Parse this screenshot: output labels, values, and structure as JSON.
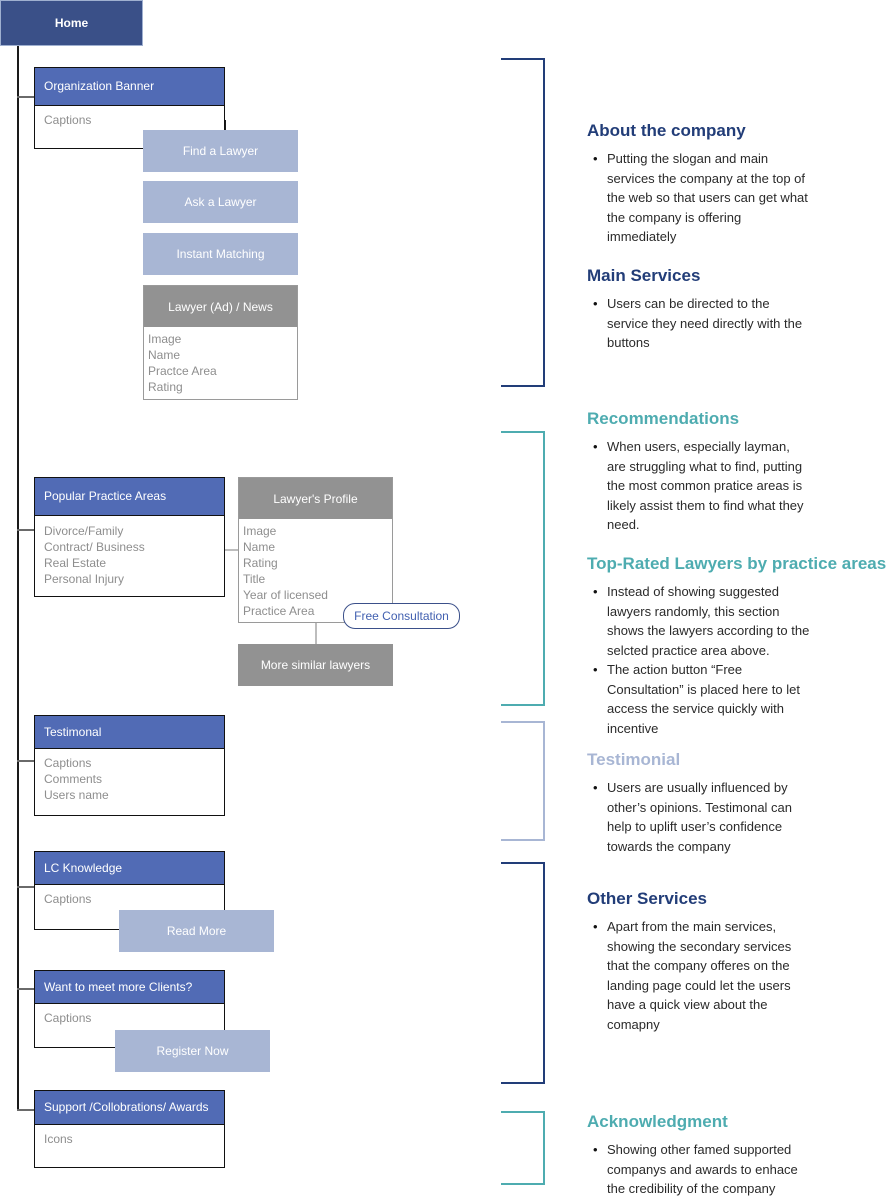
{
  "colors": {
    "dark_navy": "#223d78",
    "teal": "#4eacb0",
    "light_blue": "#a8b6d4",
    "section_header": "#516bb5",
    "home": "#3a5088",
    "grey": "#929292"
  },
  "home": {
    "label": "Home"
  },
  "sections": [
    {
      "title": "Organization Banner",
      "items": [
        "Captions"
      ]
    },
    {
      "title": "Popular Practice Areas",
      "items": [
        "Divorce/Family",
        "Contract/ Business",
        "Real Estate",
        "Personal Injury"
      ]
    },
    {
      "title": "Testimonal",
      "items": [
        "Captions",
        "Comments",
        "Users name"
      ]
    },
    {
      "title": "LC Knowledge",
      "items": [
        "Captions"
      ]
    },
    {
      "title": "Want to meet more Clients?",
      "items": [
        "Captions"
      ]
    },
    {
      "title": "Support /Collobrations/ Awards",
      "items": [
        "Icons"
      ]
    }
  ],
  "main_services_buttons": [
    "Find a Lawyer",
    "Ask a Lawyer",
    "Instant Matching"
  ],
  "lawyer_ad": {
    "title": "Lawyer (Ad) / News",
    "items": [
      "Image",
      "Name",
      "Practce Area",
      "Rating"
    ]
  },
  "lawyer_profile": {
    "title": "Lawyer's Profile",
    "items": [
      "Image",
      "Name",
      "Rating",
      "Title",
      "Year of licensed",
      "Practice Area"
    ]
  },
  "free_consultation": "Free Consultation",
  "more_similar": "More similar lawyers",
  "read_more": "Read More",
  "register_now": "Register Now",
  "annotations": [
    {
      "title": "About the company",
      "color": "#223d78",
      "bullets": [
        "Putting the slogan and main services the company at the top of the web so that users can get what the company is offering immediately"
      ]
    },
    {
      "title": "Main Services",
      "color": "#223d78",
      "bullets": [
        "Users can be directed to the service they need directly with the buttons"
      ]
    },
    {
      "title": "Recommendations",
      "color": "#4eacb0",
      "bullets": [
        "When users, especially layman, are struggling what to find, putting the most common pratice areas is likely assist them to find what they need."
      ]
    },
    {
      "title": "Top-Rated Lawyers by practice areas",
      "color": "#4eacb0",
      "bullets": [
        "Instead of showing suggested lawyers randomly, this section shows the lawyers according to the selcted practice area above.",
        "The action button “Free Consultation” is placed here to let access the service quickly with incentive"
      ]
    },
    {
      "title": "Testimonial",
      "color": "#a8b6d4",
      "bullets": [
        "Users are usually influenced by other’s opinions. Testimonal can help to uplift user’s confidence towards the company"
      ]
    },
    {
      "title": "Other Services",
      "color": "#223d78",
      "bullets": [
        "Apart from the main services, showing the secondary services that the company offeres on the landing page could let the users have a quick view about the comapny"
      ]
    },
    {
      "title": "Acknowledgment",
      "color": "#4eacb0",
      "bullets": [
        "Showing other famed supported companys and awards to enhace the credibility of the company"
      ]
    }
  ]
}
